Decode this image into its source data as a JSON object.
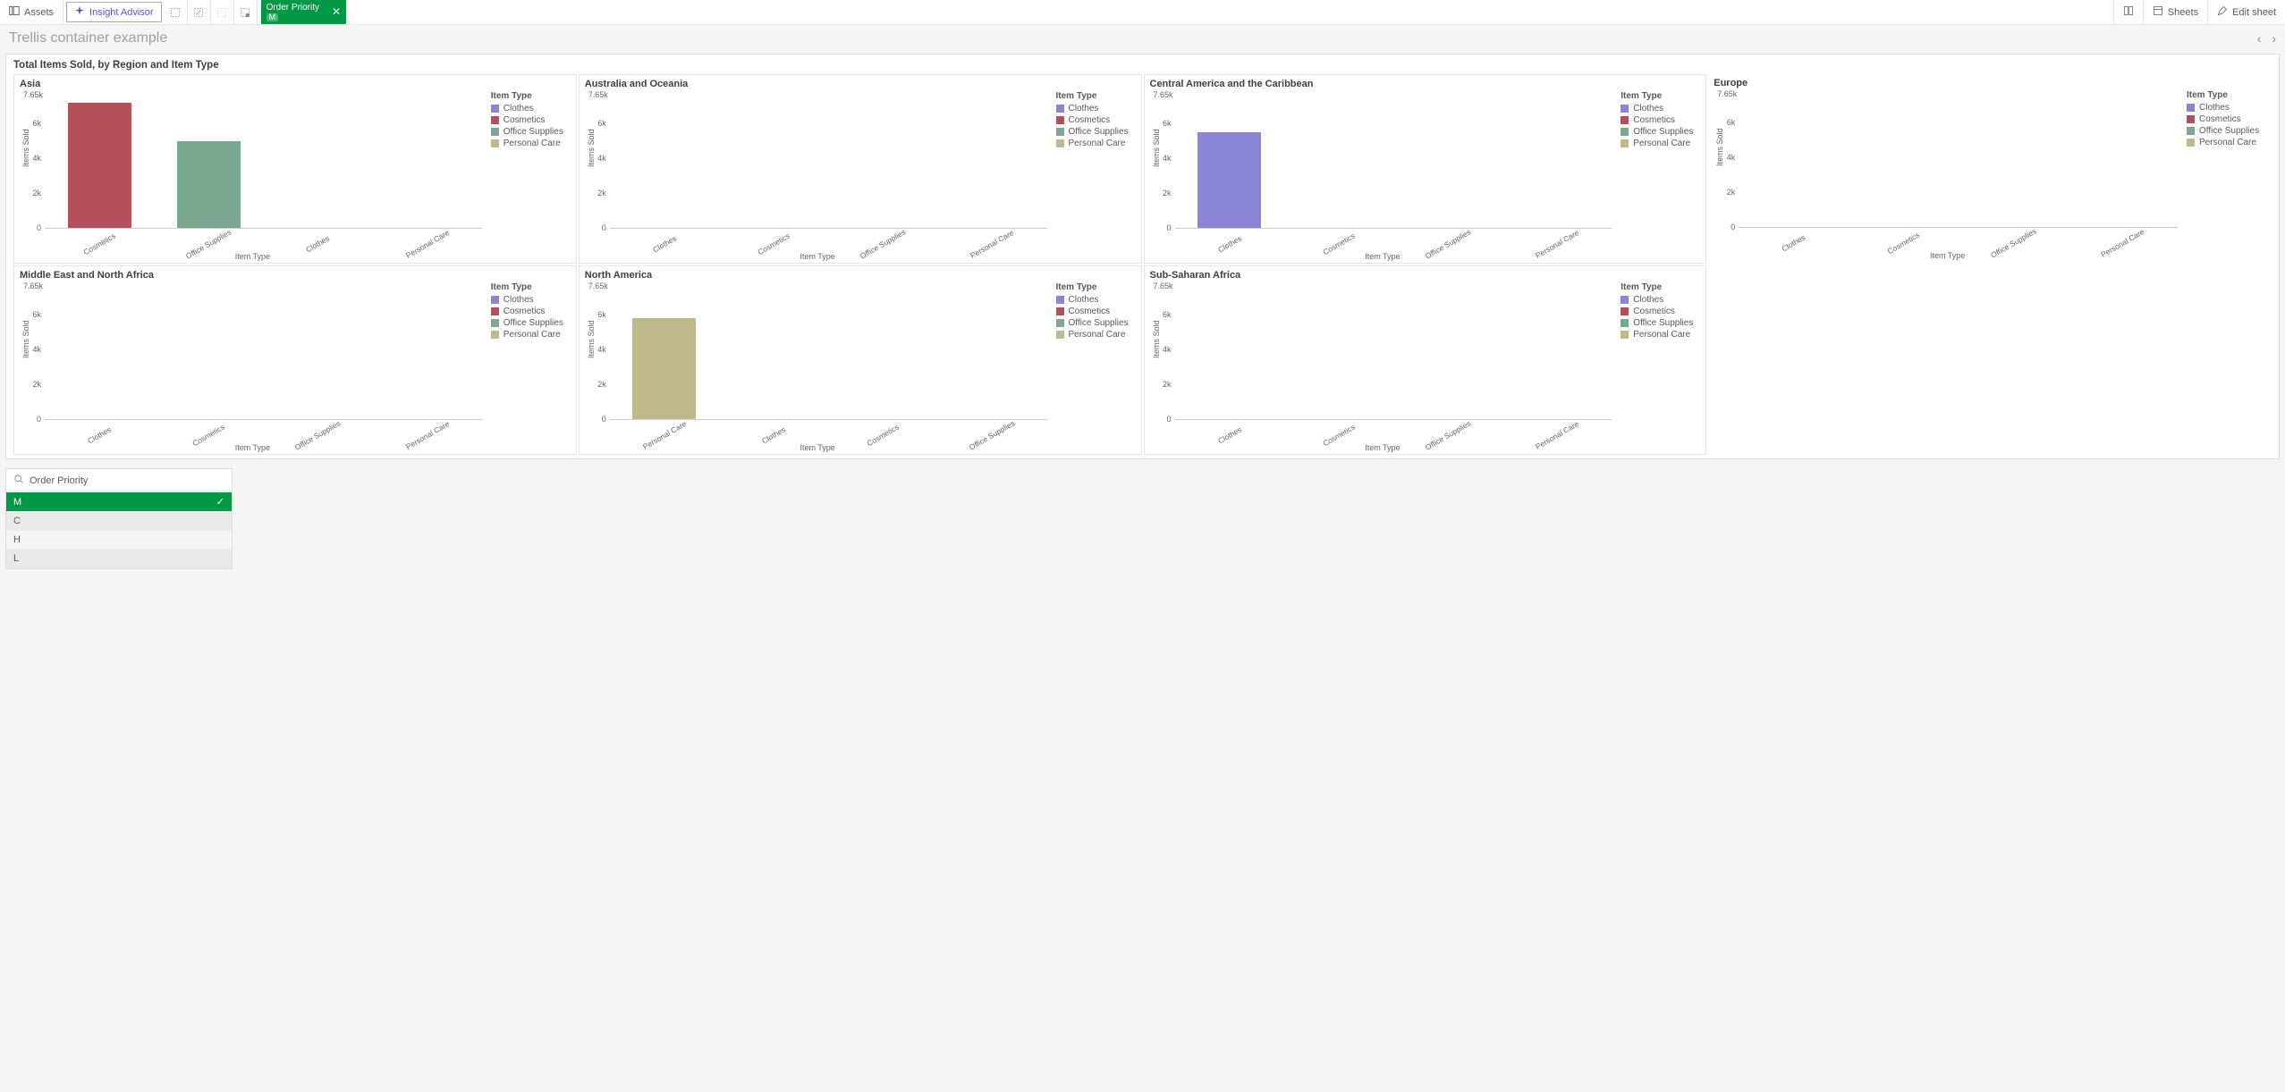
{
  "toolbar": {
    "assets": "Assets",
    "insight": "Insight Advisor",
    "chip": {
      "title": "Order Priority",
      "value": "M"
    },
    "sheets": "Sheets",
    "edit": "Edit sheet"
  },
  "sheet": {
    "title": "Trellis container example"
  },
  "chart_title": "Total Items Sold, by Region and Item Type",
  "legend": {
    "title": "Item Type",
    "items": [
      {
        "label": "Clothes",
        "color": "#8a85d6"
      },
      {
        "label": "Cosmetics",
        "color": "#b54f5a"
      },
      {
        "label": "Office Supplies",
        "color": "#79a78f"
      },
      {
        "label": "Personal Care",
        "color": "#c0b98b"
      }
    ]
  },
  "axis": {
    "ylabel": "Items Sold",
    "xlabel": "Item Type",
    "ymax": 7650,
    "yticks": [
      {
        "label": "7.65k",
        "value": 7650
      },
      {
        "label": "6k",
        "value": 6000
      },
      {
        "label": "4k",
        "value": 4000
      },
      {
        "label": "2k",
        "value": 2000
      },
      {
        "label": "0",
        "value": 0
      }
    ]
  },
  "chart_data": [
    {
      "region": "Asia",
      "categories": [
        "Cosmetics",
        "Office Supplies",
        "Clothes",
        "Personal Care"
      ],
      "series": [
        {
          "label": "Cosmetics",
          "value": 7200,
          "color": "#b54f5a"
        },
        {
          "label": "Office Supplies",
          "value": 5000,
          "color": "#79a78f"
        },
        {
          "label": "Clothes",
          "value": 0,
          "color": "#8a85d6"
        },
        {
          "label": "Personal Care",
          "value": 0,
          "color": "#c0b98b"
        }
      ],
      "type": "bar",
      "ylabel": "Items Sold",
      "xlabel": "Item Type",
      "ylim": [
        0,
        7650
      ]
    },
    {
      "region": "Australia and Oceania",
      "categories": [
        "Clothes",
        "Cosmetics",
        "Office Supplies",
        "Personal Care"
      ],
      "series": [
        {
          "label": "Clothes",
          "value": 0,
          "color": "#8a85d6"
        },
        {
          "label": "Cosmetics",
          "value": 0,
          "color": "#b54f5a"
        },
        {
          "label": "Office Supplies",
          "value": 0,
          "color": "#79a78f"
        },
        {
          "label": "Personal Care",
          "value": 0,
          "color": "#c0b98b"
        }
      ],
      "type": "bar",
      "ylabel": "Items Sold",
      "xlabel": "Item Type",
      "ylim": [
        0,
        7650
      ]
    },
    {
      "region": "Central America and the Caribbean",
      "categories": [
        "Clothes",
        "Cosmetics",
        "Office Supplies",
        "Personal Care"
      ],
      "series": [
        {
          "label": "Clothes",
          "value": 5500,
          "color": "#8a85d6"
        },
        {
          "label": "Cosmetics",
          "value": 0,
          "color": "#b54f5a"
        },
        {
          "label": "Office Supplies",
          "value": 0,
          "color": "#79a78f"
        },
        {
          "label": "Personal Care",
          "value": 0,
          "color": "#c0b98b"
        }
      ],
      "type": "bar",
      "ylabel": "Items Sold",
      "xlabel": "Item Type",
      "ylim": [
        0,
        7650
      ]
    },
    {
      "region": "Europe",
      "categories": [
        "Clothes",
        "Cosmetics",
        "Office Supplies",
        "Personal Care"
      ],
      "series": [
        {
          "label": "Clothes",
          "value": 0,
          "color": "#8a85d6"
        },
        {
          "label": "Cosmetics",
          "value": 0,
          "color": "#b54f5a"
        },
        {
          "label": "Office Supplies",
          "value": 0,
          "color": "#79a78f"
        },
        {
          "label": "Personal Care",
          "value": 0,
          "color": "#c0b98b"
        }
      ],
      "type": "bar",
      "ylabel": "Items Sold",
      "xlabel": "Item Type",
      "ylim": [
        0,
        7650
      ]
    },
    {
      "region": "Middle East and North Africa",
      "categories": [
        "Clothes",
        "Cosmetics",
        "Office Supplies",
        "Personal Care"
      ],
      "series": [
        {
          "label": "Clothes",
          "value": 0,
          "color": "#8a85d6"
        },
        {
          "label": "Cosmetics",
          "value": 0,
          "color": "#b54f5a"
        },
        {
          "label": "Office Supplies",
          "value": 0,
          "color": "#79a78f"
        },
        {
          "label": "Personal Care",
          "value": 0,
          "color": "#c0b98b"
        }
      ],
      "type": "bar",
      "ylabel": "Items Sold",
      "xlabel": "Item Type",
      "ylim": [
        0,
        7650
      ]
    },
    {
      "region": "North America",
      "categories": [
        "Personal Care",
        "Clothes",
        "Cosmetics",
        "Office Supplies"
      ],
      "series": [
        {
          "label": "Personal Care",
          "value": 5800,
          "color": "#c0b98b"
        },
        {
          "label": "Clothes",
          "value": 0,
          "color": "#8a85d6"
        },
        {
          "label": "Cosmetics",
          "value": 0,
          "color": "#b54f5a"
        },
        {
          "label": "Office Supplies",
          "value": 0,
          "color": "#79a78f"
        }
      ],
      "type": "bar",
      "ylabel": "Items Sold",
      "xlabel": "Item Type",
      "ylim": [
        0,
        7650
      ]
    },
    {
      "region": "Sub-Saharan Africa",
      "categories": [
        "Clothes",
        "Cosmetics",
        "Office Supplies",
        "Personal Care"
      ],
      "series": [
        {
          "label": "Clothes",
          "value": 0,
          "color": "#8a85d6"
        },
        {
          "label": "Cosmetics",
          "value": 0,
          "color": "#b54f5a"
        },
        {
          "label": "Office Supplies",
          "value": 0,
          "color": "#79a78f"
        },
        {
          "label": "Personal Care",
          "value": 0,
          "color": "#c0b98b"
        }
      ],
      "type": "bar",
      "ylabel": "Items Sold",
      "xlabel": "Item Type",
      "ylim": [
        0,
        7650
      ]
    }
  ],
  "filter": {
    "title": "Order Priority",
    "items": [
      {
        "label": "M",
        "selected": true
      },
      {
        "label": "C",
        "selected": false
      },
      {
        "label": "H",
        "selected": false
      },
      {
        "label": "L",
        "selected": false
      }
    ]
  }
}
